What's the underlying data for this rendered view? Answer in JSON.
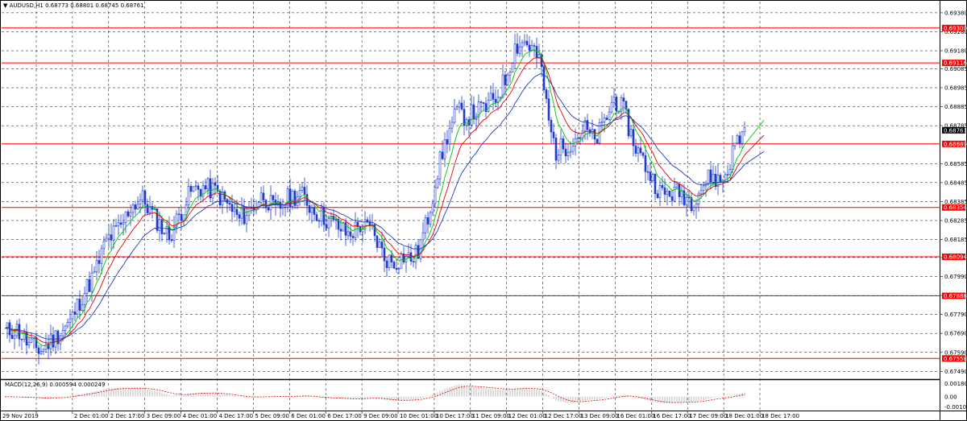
{
  "header": {
    "symbol": "AUDUSD,H1",
    "ohlc": "0.68773 0.68801 0.68745 0.68761"
  },
  "macd": {
    "label": "MACD(12,26,9) 0.000594 0.000249"
  },
  "colors": {
    "background": "#ffffff",
    "grid": "#000000",
    "candle": "#1e3cc8",
    "ma_fast": "#00c800",
    "ma_mid": "#e60000",
    "ma_slow": "#1e3cc8",
    "level_line": "#ff0000",
    "level_label_bg": "#ff0000",
    "level_label_text": "#ffffff",
    "price_label_bg": "#000000",
    "macd_hist": "#b4b4b4",
    "macd_signal": "#e60000"
  },
  "chart_data": {
    "type": "candlestick",
    "instrument": "AUDUSD",
    "timeframe": "H1",
    "price_axis": {
      "range": [
        0.67449,
        0.69439
      ],
      "ticks": [
        "0.69380",
        "0.69280",
        "0.69180",
        "0.69085",
        "0.68985",
        "0.68885",
        "0.68785",
        "0.68585",
        "0.68485",
        "0.68385",
        "0.68285",
        "0.68185",
        "0.68090",
        "0.67990",
        "0.67890",
        "0.67790",
        "0.67690",
        "0.67590",
        "0.67490"
      ],
      "current_price": "0.68761"
    },
    "levels": [
      "0.69300",
      "0.69116",
      "0.68689",
      "0.68354",
      "0.68094",
      "0.67888",
      "0.67558"
    ],
    "time_axis": {
      "labels": [
        "29 Nov 2019",
        "2 Dec 01:00",
        "2 Dec 17:00",
        "3 Dec 09:00",
        "4 Dec 01:00",
        "4 Dec 17:00",
        "5 Dec 09:00",
        "6 Dec 01:00",
        "6 Dec 17:00",
        "9 Dec 09:00",
        "10 Dec 01:00",
        "10 Dec 17:00",
        "11 Dec 09:00",
        "12 Dec 01:00",
        "12 Dec 17:00",
        "13 Dec 09:00",
        "16 Dec 01:00",
        "16 Dec 17:00",
        "17 Dec 09:00",
        "18 Dec 01:00",
        "18 Dec 17:00"
      ]
    },
    "price_path": [
      {
        "t": 0,
        "p": 0.677
      },
      {
        "t": 5,
        "p": 0.6771
      },
      {
        "t": 10,
        "p": 0.6763
      },
      {
        "t": 15,
        "p": 0.676
      },
      {
        "t": 20,
        "p": 0.6766
      },
      {
        "t": 27,
        "p": 0.6775
      },
      {
        "t": 32,
        "p": 0.6789
      },
      {
        "t": 37,
        "p": 0.68
      },
      {
        "t": 42,
        "p": 0.6818
      },
      {
        "t": 48,
        "p": 0.6825
      },
      {
        "t": 52,
        "p": 0.6836
      },
      {
        "t": 57,
        "p": 0.684
      },
      {
        "t": 62,
        "p": 0.683
      },
      {
        "t": 68,
        "p": 0.682
      },
      {
        "t": 72,
        "p": 0.6831
      },
      {
        "t": 77,
        "p": 0.6844
      },
      {
        "t": 82,
        "p": 0.6846
      },
      {
        "t": 87,
        "p": 0.6844
      },
      {
        "t": 92,
        "p": 0.6837
      },
      {
        "t": 97,
        "p": 0.6829
      },
      {
        "t": 102,
        "p": 0.6835
      },
      {
        "t": 107,
        "p": 0.6842
      },
      {
        "t": 112,
        "p": 0.6833
      },
      {
        "t": 117,
        "p": 0.684
      },
      {
        "t": 122,
        "p": 0.6843
      },
      {
        "t": 127,
        "p": 0.6835
      },
      {
        "t": 132,
        "p": 0.683
      },
      {
        "t": 137,
        "p": 0.6826
      },
      {
        "t": 142,
        "p": 0.6821
      },
      {
        "t": 147,
        "p": 0.6826
      },
      {
        "t": 152,
        "p": 0.6823
      },
      {
        "t": 157,
        "p": 0.6809
      },
      {
        "t": 161,
        "p": 0.6806
      },
      {
        "t": 165,
        "p": 0.681
      },
      {
        "t": 168,
        "p": 0.6808
      },
      {
        "t": 171,
        "p": 0.6812
      },
      {
        "t": 175,
        "p": 0.683
      },
      {
        "t": 179,
        "p": 0.6855
      },
      {
        "t": 183,
        "p": 0.6873
      },
      {
        "t": 187,
        "p": 0.6886
      },
      {
        "t": 191,
        "p": 0.6883
      },
      {
        "t": 195,
        "p": 0.6886
      },
      {
        "t": 199,
        "p": 0.6888
      },
      {
        "t": 203,
        "p": 0.6893
      },
      {
        "t": 207,
        "p": 0.6903
      },
      {
        "t": 211,
        "p": 0.692
      },
      {
        "t": 215,
        "p": 0.6923
      },
      {
        "t": 219,
        "p": 0.6918
      },
      {
        "t": 222,
        "p": 0.6908
      },
      {
        "t": 225,
        "p": 0.688
      },
      {
        "t": 228,
        "p": 0.6865
      },
      {
        "t": 232,
        "p": 0.6868
      },
      {
        "t": 236,
        "p": 0.6872
      },
      {
        "t": 240,
        "p": 0.6877
      },
      {
        "t": 244,
        "p": 0.687
      },
      {
        "t": 248,
        "p": 0.688
      },
      {
        "t": 252,
        "p": 0.6893
      },
      {
        "t": 256,
        "p": 0.6886
      },
      {
        "t": 260,
        "p": 0.687
      },
      {
        "t": 264,
        "p": 0.686
      },
      {
        "t": 268,
        "p": 0.685
      },
      {
        "t": 272,
        "p": 0.6842
      },
      {
        "t": 276,
        "p": 0.6843
      },
      {
        "t": 280,
        "p": 0.6843
      },
      {
        "t": 284,
        "p": 0.6839
      },
      {
        "t": 288,
        "p": 0.6846
      },
      {
        "t": 292,
        "p": 0.6852
      },
      {
        "t": 296,
        "p": 0.6849
      },
      {
        "t": 299,
        "p": 0.6855
      },
      {
        "t": 302,
        "p": 0.6869
      },
      {
        "t": 306,
        "p": 0.6876
      }
    ],
    "moving_averages": [
      {
        "periods": 8,
        "color": "ma_fast"
      },
      {
        "periods": 14,
        "color": "ma_mid"
      },
      {
        "periods": 26,
        "color": "ma_slow"
      }
    ]
  }
}
